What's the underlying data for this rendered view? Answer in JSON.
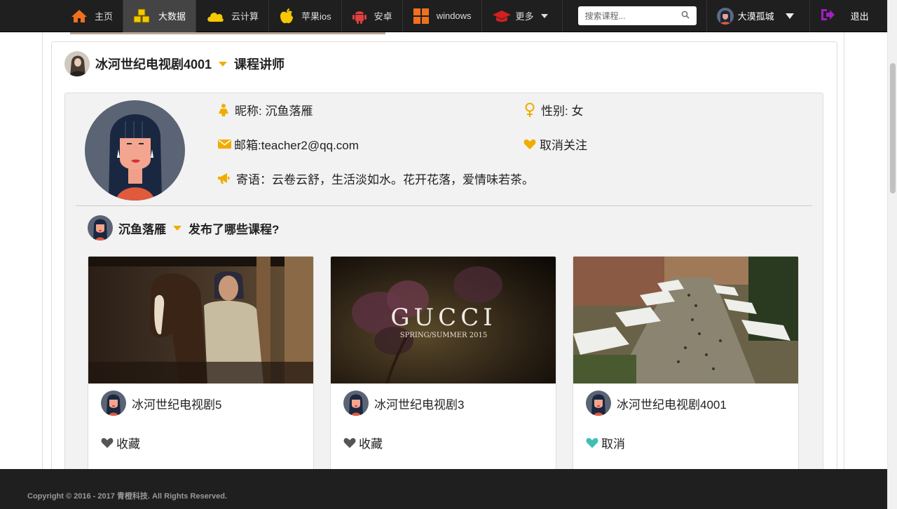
{
  "nav": {
    "items": [
      {
        "label": "主页",
        "icon": "home-icon"
      },
      {
        "label": "大数据",
        "icon": "cubes-icon"
      },
      {
        "label": "云计算",
        "icon": "cloud-icon"
      },
      {
        "label": "苹果ios",
        "icon": "apple-icon"
      },
      {
        "label": "安卓",
        "icon": "android-icon"
      },
      {
        "label": "windows",
        "icon": "windows-icon"
      },
      {
        "label": "更多",
        "icon": "graduation-cap-icon"
      }
    ],
    "search_placeholder": "搜索课程...",
    "user_name": "大漠孤城",
    "logout_label": "退出"
  },
  "course_header": {
    "title": "冰河世纪电视剧4001",
    "subtitle": "课程讲师"
  },
  "teacher": {
    "nickname": "昵称: 沉鱼落雁",
    "gender": "性别: 女",
    "email": "邮箱:teacher2@qq.com",
    "follow": "取消关注",
    "motto": "寄语：云卷云舒，生活淡如水。花开花落，爱情味若茶。"
  },
  "published": {
    "name": "沉鱼落雁",
    "question": "发布了哪些课程?"
  },
  "courses": [
    {
      "title": "冰河世纪电视剧5",
      "action": "收藏",
      "thumb_text": ""
    },
    {
      "title": "冰河世纪电视剧3",
      "action": "收藏",
      "thumb_text": "GUCCI",
      "thumb_sub": "SPRING/SUMMER 2015"
    },
    {
      "title": "冰河世纪电视剧4001",
      "action": "取消",
      "thumb_text": ""
    }
  ],
  "footer": {
    "copyright": "Copyright © 2016 - 2017 青橙科技. All Rights Reserved."
  },
  "colors": {
    "navbar": "#1f1f1f",
    "accent": "#f0ad00",
    "heart_active": "#3fbfb4",
    "heart_inactive": "#555555"
  }
}
